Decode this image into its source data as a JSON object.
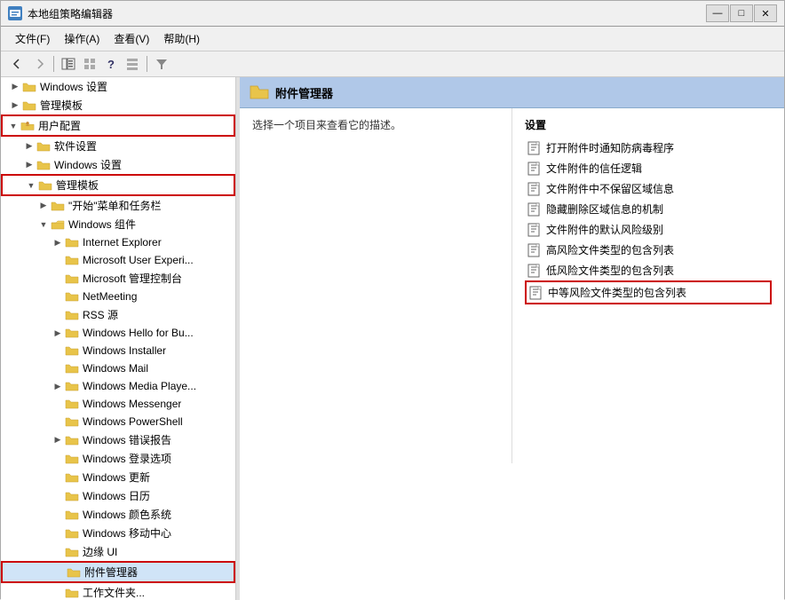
{
  "window": {
    "title": "本地组策略编辑器",
    "title_icon": "gpedit"
  },
  "menubar": {
    "items": [
      {
        "id": "file",
        "label": "文件(F)"
      },
      {
        "id": "action",
        "label": "操作(A)"
      },
      {
        "id": "view",
        "label": "查看(V)"
      },
      {
        "id": "help",
        "label": "帮助(H)"
      }
    ]
  },
  "content_header": {
    "title": "附件管理器"
  },
  "content_description": {
    "text": "选择一个项目来查看它的描述。"
  },
  "settings_panel": {
    "title": "设置",
    "items": [
      {
        "id": "item1",
        "label": "打开附件时通知防病毒程序",
        "highlighted": false
      },
      {
        "id": "item2",
        "label": "文件附件的信任逻辑",
        "highlighted": false
      },
      {
        "id": "item3",
        "label": "文件附件中不保留区域信息",
        "highlighted": false
      },
      {
        "id": "item4",
        "label": "隐藏删除区域信息的机制",
        "highlighted": false
      },
      {
        "id": "item5",
        "label": "文件附件的默认风险级别",
        "highlighted": false
      },
      {
        "id": "item6",
        "label": "高风险文件类型的包含列表",
        "highlighted": false
      },
      {
        "id": "item7",
        "label": "低风险文件类型的包含列表",
        "highlighted": false
      },
      {
        "id": "item8",
        "label": "中等风险文件类型的包含列表",
        "highlighted": true
      }
    ]
  },
  "tree": {
    "nodes": [
      {
        "id": "win-settings-top",
        "label": "Windows 设置",
        "level": 1,
        "indent": "indent1",
        "expanded": false,
        "type": "folder"
      },
      {
        "id": "admin-templates-top",
        "label": "管理模板",
        "level": 1,
        "indent": "indent1",
        "expanded": false,
        "type": "folder"
      },
      {
        "id": "user-config",
        "label": "用户配置",
        "level": 0,
        "indent": "indent0",
        "expanded": true,
        "type": "folder-open",
        "highlighted": true
      },
      {
        "id": "software-settings",
        "label": "软件设置",
        "level": 1,
        "indent": "indent2",
        "expanded": false,
        "type": "folder"
      },
      {
        "id": "win-settings",
        "label": "Windows 设置",
        "level": 1,
        "indent": "indent2",
        "expanded": false,
        "type": "folder"
      },
      {
        "id": "admin-templates",
        "label": "管理模板",
        "level": 1,
        "indent": "indent2",
        "expanded": true,
        "type": "folder-open",
        "highlighted": true
      },
      {
        "id": "start-menu",
        "label": "\"开始\"菜单和任务栏",
        "level": 2,
        "indent": "indent3",
        "expanded": false,
        "type": "folder"
      },
      {
        "id": "win-components",
        "label": "Windows 组件",
        "level": 2,
        "indent": "indent3",
        "expanded": true,
        "type": "folder-open"
      },
      {
        "id": "ie",
        "label": "Internet Explorer",
        "level": 3,
        "indent": "indent4",
        "expanded": false,
        "type": "folder"
      },
      {
        "id": "ms-user-exp",
        "label": "Microsoft User Experi...",
        "level": 3,
        "indent": "indent4",
        "expanded": false,
        "type": "folder"
      },
      {
        "id": "ms-mgmt",
        "label": "Microsoft 管理控制台",
        "level": 3,
        "indent": "indent4",
        "expanded": false,
        "type": "folder"
      },
      {
        "id": "netmeeting",
        "label": "NetMeeting",
        "level": 3,
        "indent": "indent4",
        "expanded": false,
        "type": "folder"
      },
      {
        "id": "rss",
        "label": "RSS 源",
        "level": 3,
        "indent": "indent4",
        "expanded": false,
        "type": "folder"
      },
      {
        "id": "win-hello",
        "label": "Windows Hello for Bu...",
        "level": 3,
        "indent": "indent4",
        "expanded": false,
        "type": "folder"
      },
      {
        "id": "win-installer",
        "label": "Windows Installer",
        "level": 3,
        "indent": "indent4",
        "expanded": false,
        "type": "folder"
      },
      {
        "id": "win-mail",
        "label": "Windows Mail",
        "level": 3,
        "indent": "indent4",
        "expanded": false,
        "type": "folder"
      },
      {
        "id": "win-media",
        "label": "Windows Media Playe...",
        "level": 3,
        "indent": "indent4",
        "expanded": false,
        "type": "folder"
      },
      {
        "id": "win-messenger",
        "label": "Windows Messenger",
        "level": 3,
        "indent": "indent4",
        "expanded": false,
        "type": "folder"
      },
      {
        "id": "win-powershell",
        "label": "Windows PowerShell",
        "level": 3,
        "indent": "indent4",
        "expanded": false,
        "type": "folder"
      },
      {
        "id": "win-error",
        "label": "Windows 错误报告",
        "level": 3,
        "indent": "indent4",
        "expanded": false,
        "type": "folder"
      },
      {
        "id": "win-logon",
        "label": "Windows 登录选项",
        "level": 3,
        "indent": "indent4",
        "expanded": false,
        "type": "folder"
      },
      {
        "id": "win-update",
        "label": "Windows 更新",
        "level": 3,
        "indent": "indent4",
        "expanded": false,
        "type": "folder"
      },
      {
        "id": "win-calendar",
        "label": "Windows 日历",
        "level": 3,
        "indent": "indent4",
        "expanded": false,
        "type": "folder"
      },
      {
        "id": "win-color",
        "label": "Windows 颜色系统",
        "level": 3,
        "indent": "indent4",
        "expanded": false,
        "type": "folder"
      },
      {
        "id": "win-mobility",
        "label": "Windows 移动中心",
        "level": 3,
        "indent": "indent4",
        "expanded": false,
        "type": "folder"
      },
      {
        "id": "sidebar-ui",
        "label": "边缘 UI",
        "level": 3,
        "indent": "indent4",
        "expanded": false,
        "type": "folder"
      },
      {
        "id": "attachment-mgr",
        "label": "附件管理器",
        "level": 3,
        "indent": "indent4",
        "expanded": false,
        "type": "folder",
        "highlighted": true,
        "selected": true
      },
      {
        "id": "work-folder",
        "label": "工作文件夹...",
        "level": 3,
        "indent": "indent4",
        "expanded": false,
        "type": "folder"
      }
    ]
  }
}
